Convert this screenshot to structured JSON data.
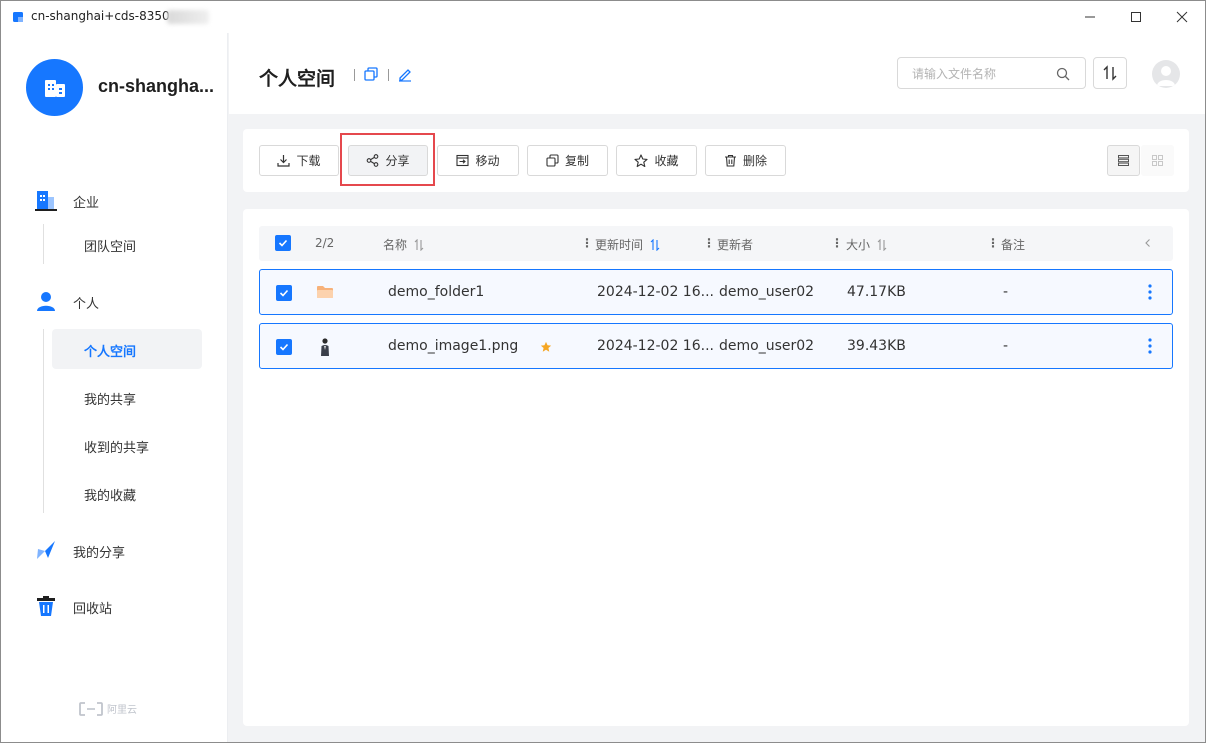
{
  "window": {
    "title": "cn-shanghai+cds-8350",
    "min_icon": "minimize-icon",
    "max_icon": "maximize-icon",
    "close_icon": "close-icon"
  },
  "sidebar": {
    "org_name": "cn-shangha...",
    "groups": [
      {
        "label": "企业",
        "icon": "enterprise-icon"
      },
      {
        "label": "个人",
        "icon": "person-icon"
      },
      {
        "label": "我的分享",
        "icon": "paper-plane-icon"
      },
      {
        "label": "回收站",
        "icon": "trash-bin-icon"
      }
    ],
    "enterprise_sub": [
      {
        "label": "团队空间"
      }
    ],
    "personal_sub": [
      {
        "label": "个人空间",
        "active": true
      },
      {
        "label": "我的共享"
      },
      {
        "label": "收到的共享"
      },
      {
        "label": "我的收藏"
      }
    ],
    "brand": "阿里云"
  },
  "header": {
    "title": "个人空间",
    "search_placeholder": "请输入文件名称"
  },
  "toolbar": {
    "buttons": [
      {
        "label": "下载",
        "icon": "download-icon"
      },
      {
        "label": "分享",
        "icon": "share-icon",
        "highlighted": true
      },
      {
        "label": "移动",
        "icon": "move-icon"
      },
      {
        "label": "复制",
        "icon": "copy-icon"
      },
      {
        "label": "收藏",
        "icon": "star-icon"
      },
      {
        "label": "删除",
        "icon": "trash-icon"
      }
    ]
  },
  "table": {
    "selection": "2/2",
    "columns": {
      "name": "名称",
      "updated": "更新时间",
      "updater": "更新者",
      "size": "大小",
      "note": "备注"
    },
    "rows": [
      {
        "name": "demo_folder1",
        "type": "folder",
        "starred": false,
        "updated": "2024-12-02 16...",
        "updater": "demo_user02",
        "size": "47.17KB",
        "note": "-"
      },
      {
        "name": "demo_image1.png",
        "type": "image",
        "starred": true,
        "updated": "2024-12-02 16...",
        "updater": "demo_user02",
        "size": "39.43KB",
        "note": "-"
      }
    ]
  },
  "colors": {
    "accent": "#1677ff",
    "highlight": "#e5484d",
    "star": "#f5a623",
    "folder": "#f7b27a"
  }
}
